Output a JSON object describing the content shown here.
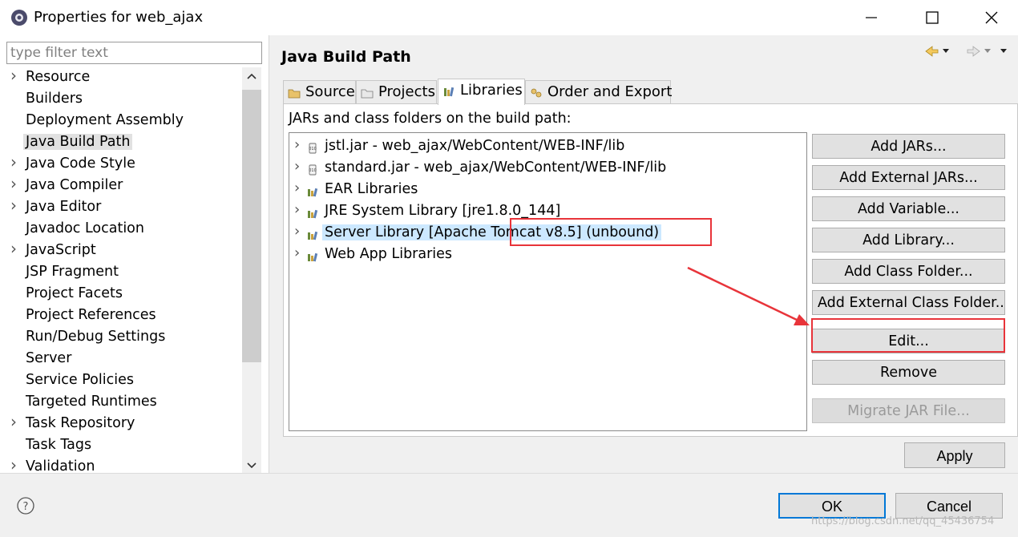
{
  "window": {
    "title": "Properties for web_ajax"
  },
  "filter": {
    "placeholder": "type filter text"
  },
  "nav_tree": {
    "items": [
      {
        "label": "Resource",
        "expandable": true
      },
      {
        "label": "Builders",
        "expandable": false
      },
      {
        "label": "Deployment Assembly",
        "expandable": false
      },
      {
        "label": "Java Build Path",
        "expandable": false,
        "selected": true
      },
      {
        "label": "Java Code Style",
        "expandable": true
      },
      {
        "label": "Java Compiler",
        "expandable": true
      },
      {
        "label": "Java Editor",
        "expandable": true
      },
      {
        "label": "Javadoc Location",
        "expandable": false
      },
      {
        "label": "JavaScript",
        "expandable": true
      },
      {
        "label": "JSP Fragment",
        "expandable": false
      },
      {
        "label": "Project Facets",
        "expandable": false
      },
      {
        "label": "Project References",
        "expandable": false
      },
      {
        "label": "Run/Debug Settings",
        "expandable": false
      },
      {
        "label": "Server",
        "expandable": false
      },
      {
        "label": "Service Policies",
        "expandable": false
      },
      {
        "label": "Targeted Runtimes",
        "expandable": false
      },
      {
        "label": "Task Repository",
        "expandable": true
      },
      {
        "label": "Task Tags",
        "expandable": false
      },
      {
        "label": "Validation",
        "expandable": true
      }
    ]
  },
  "main": {
    "title": "Java Build Path",
    "tabs": [
      {
        "label": "Source",
        "icon": "source-folder-icon"
      },
      {
        "label": "Projects",
        "icon": "project-icon"
      },
      {
        "label": "Libraries",
        "icon": "library-icon",
        "active": true
      },
      {
        "label": "Order and Export",
        "icon": "order-icon"
      }
    ],
    "build_path_label": "JARs and class folders on the build path:",
    "entries": [
      {
        "label": "jstl.jar - web_ajax/WebContent/WEB-INF/lib",
        "icon": "jar-icon"
      },
      {
        "label": "standard.jar - web_ajax/WebContent/WEB-INF/lib",
        "icon": "jar-icon"
      },
      {
        "label": "EAR Libraries",
        "icon": "library-icon"
      },
      {
        "label": "JRE System Library [jre1.8.0_144]",
        "icon": "library-icon"
      },
      {
        "label": "Server Library [Apache Tomcat v8.5] (unbound)",
        "icon": "library-icon",
        "selected": true
      },
      {
        "label": "Web App Libraries",
        "icon": "library-icon"
      }
    ],
    "buttons": {
      "add_jars": "Add JARs...",
      "add_external_jars": "Add External JARs...",
      "add_variable": "Add Variable...",
      "add_library": "Add Library...",
      "add_class_folder": "Add Class Folder...",
      "add_external_class_folder": "Add External Class Folder...",
      "edit": "Edit...",
      "remove": "Remove",
      "migrate_jar": "Migrate JAR File..."
    },
    "apply": "Apply"
  },
  "footer": {
    "ok": "OK",
    "cancel": "Cancel",
    "watermark": "https://blog.csdn.net/qq_45436754"
  },
  "colors": {
    "annotation": "#e8343a",
    "selection": "#cce8ff",
    "default_button_border": "#0078d7"
  }
}
